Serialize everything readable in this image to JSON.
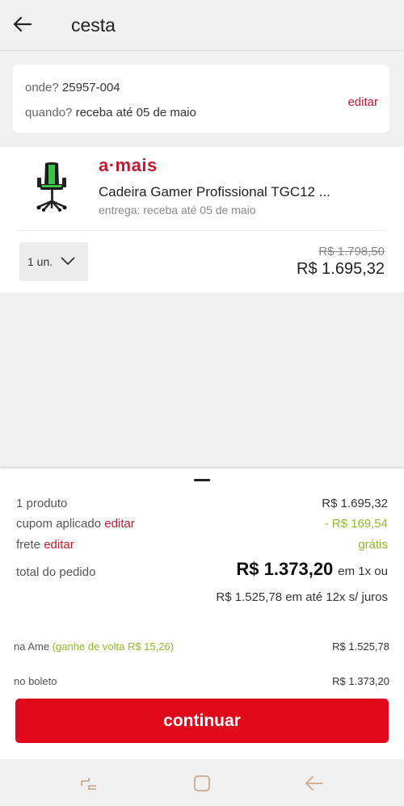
{
  "header": {
    "title": "cesta"
  },
  "delivery": {
    "where_label": "onde?",
    "where_value": "25957-004",
    "when_label": "quando?",
    "when_value": "receba até 05 de maio",
    "edit_label": "editar"
  },
  "product": {
    "brand": "a·mais",
    "name": "Cadeira Gamer Profissional TGC12 ...",
    "delivery": "entrega: receba até 05 de maio",
    "quantity": "1 un.",
    "old_price": "R$ 1.798,50",
    "price": "R$ 1.695,32"
  },
  "summary": {
    "products_label": "1 produto",
    "products_value": "R$ 1.695,32",
    "coupon_label": "cupom aplicado",
    "coupon_edit": "editar",
    "coupon_value": "- R$ 169,54",
    "shipping_label": "frete",
    "shipping_edit": "editar",
    "shipping_value": "grátis",
    "total_label": "total do pedido",
    "total_value": "R$ 1.373,20",
    "total_suffix": "em 1x ou",
    "installments": "R$ 1.525,78 em até 12x s/ juros",
    "ame_label": "na Ame",
    "ame_cashback": "(ganhe de volta R$ 15,26)",
    "ame_value": "R$ 1.525,78",
    "boleto_label": "no boleto",
    "boleto_value": "R$ 1.373,20",
    "continue_label": "continuar"
  },
  "colors": {
    "accent": "#c41830",
    "button": "#e0081a",
    "cashback_green": "#8dbb2b"
  }
}
